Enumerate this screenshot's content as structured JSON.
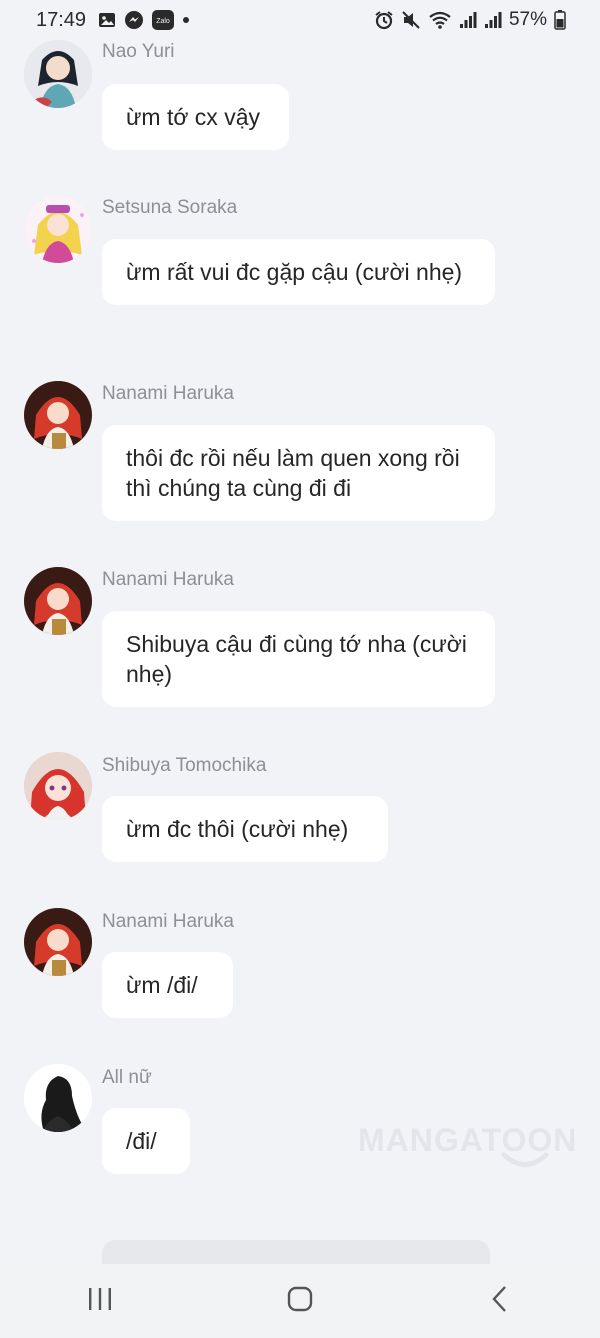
{
  "status": {
    "time": "17:49",
    "battery": "57%",
    "left_icons": [
      "gallery-icon",
      "messenger-icon",
      "zalo-icon",
      "dot-icon"
    ],
    "zalo_label": "Zalo",
    "right_icons": [
      "alarm-icon",
      "mute-icon",
      "wifi-icon",
      "signal-icon",
      "signal-icon",
      "battery-icon"
    ]
  },
  "messages": [
    {
      "sender": "Nao Yuri",
      "text": "ừm tớ cx vậy"
    },
    {
      "sender": "Setsuna Soraka",
      "text": "ừm rất vui đc gặp cậu (cười nhẹ)"
    },
    {
      "sender": "Nanami Haruka",
      "text": "thôi đc rồi nếu làm quen xong rồi thì chúng ta cùng đi đi"
    },
    {
      "sender": "Nanami Haruka",
      "text": "Shibuya cậu đi cùng tớ nha (cười nhẹ)"
    },
    {
      "sender": "Shibuya Tomochika",
      "text": "ừm đc thôi (cười nhẹ)"
    },
    {
      "sender": "Nanami Haruka",
      "text": "ừm /đi/"
    },
    {
      "sender": "All nữ",
      "text": "/đi/"
    }
  ],
  "watermark": "MANGATOON",
  "nav": {
    "recents_icon": "recents-icon",
    "home_icon": "home-icon",
    "back_icon": "back-icon"
  },
  "colors": {
    "background": "#f2f3f7",
    "bubble": "#ffffff",
    "sender_text": "#8d8f96"
  }
}
